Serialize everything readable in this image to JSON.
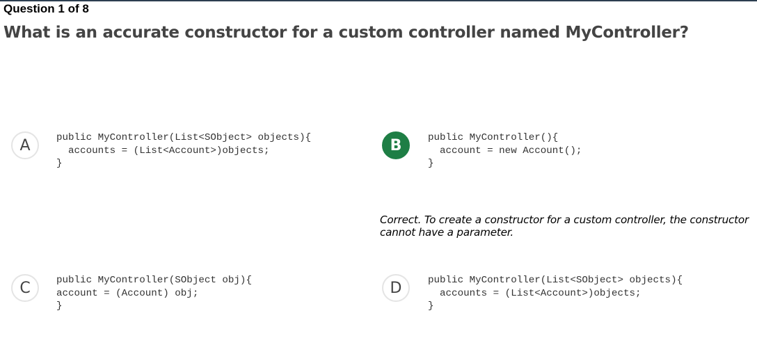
{
  "header": {
    "counter": "Question 1 of 8",
    "question": "What is an accurate constructor for a custom controller named MyController?"
  },
  "options": [
    {
      "letter": "A",
      "selected": false,
      "correct": false,
      "code": [
        "public MyController(List<SObject> objects){",
        "  accounts = (List<Account>)objects;",
        "}"
      ]
    },
    {
      "letter": "B",
      "selected": true,
      "correct": true,
      "code": [
        "public MyController(){",
        "  account = new Account();",
        "}"
      ],
      "feedback": "Correct. To create a constructor for a custom controller, the constructor cannot have a parameter."
    },
    {
      "letter": "C",
      "selected": false,
      "correct": false,
      "code": [
        "public MyController(SObject obj){",
        "account = (Account) obj;",
        "}"
      ]
    },
    {
      "letter": "D",
      "selected": false,
      "correct": false,
      "code": [
        "public MyController(List<SObject> objects){",
        "  accounts = (List<Account>)objects;",
        "}"
      ]
    }
  ],
  "colors": {
    "correct": "#1e7e45",
    "badge_border": "#e4e4e4",
    "top_rule": "#2c3e50"
  }
}
